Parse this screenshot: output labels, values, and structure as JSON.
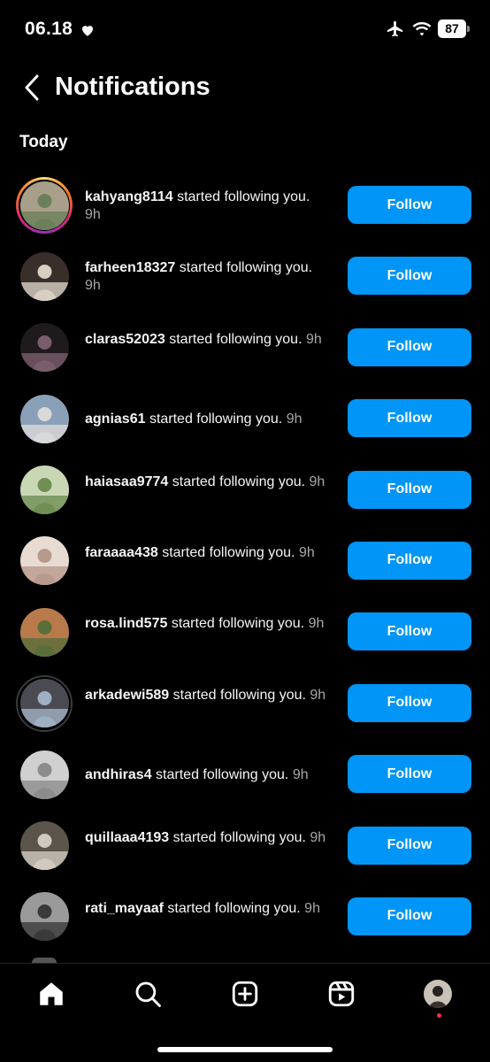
{
  "status_bar": {
    "time": "06.18",
    "battery": "87"
  },
  "header": {
    "title": "Notifications"
  },
  "section": {
    "title": "Today"
  },
  "notifications": [
    {
      "username": "kahyang8114",
      "action": "started following you.",
      "time": "9h",
      "avatar_colors": [
        "#6b7f5a",
        "#a89f8a"
      ]
    },
    {
      "username": "farheen18327",
      "action": "started following you.",
      "time": "9h",
      "avatar_colors": [
        "#d8cfc4",
        "#3a2e2a"
      ]
    },
    {
      "username": "claras52023",
      "action": "started following you.",
      "time": "9h",
      "avatar_colors": [
        "#7a5d6d",
        "#1f1a1c"
      ]
    },
    {
      "username": "agnias61",
      "action": "started following you.",
      "time": "9h",
      "avatar_colors": [
        "#d9d9d9",
        "#8aa0b8"
      ]
    },
    {
      "username": "haiasaa9774",
      "action": "started following you.",
      "time": "9h",
      "avatar_colors": [
        "#6f8f55",
        "#c9d7b5"
      ]
    },
    {
      "username": "faraaaa438",
      "action": "started following you.",
      "time": "9h",
      "avatar_colors": [
        "#b89a8c",
        "#e8dcd2"
      ]
    },
    {
      "username": "rosa.lind575",
      "action": "started following you.",
      "time": "9h",
      "avatar_colors": [
        "#5a6e3a",
        "#b87a4a"
      ]
    },
    {
      "username": "arkadewi589",
      "action": "started following you.",
      "time": "9h",
      "avatar_colors": [
        "#9fb0c2",
        "#4a4a52"
      ]
    },
    {
      "username": "andhiras4",
      "action": "started following you.",
      "time": "9h",
      "avatar_colors": [
        "#8c8c8c",
        "#d0d0d0"
      ]
    },
    {
      "username": "quillaaa4193",
      "action": "started following you.",
      "time": "9h",
      "avatar_colors": [
        "#cfc9c0",
        "#5a544a"
      ]
    },
    {
      "username": "rati_mayaaf",
      "action": "started following you.",
      "time": "9h",
      "avatar_colors": [
        "#3a3a3a",
        "#9a9a9a"
      ]
    }
  ],
  "follow_label": "Follow",
  "colors": {
    "accent": "#0095f6",
    "background": "#000000",
    "muted": "#a8a8a8"
  },
  "tab_bar": {
    "items": [
      {
        "icon": "home-icon"
      },
      {
        "icon": "search-icon"
      },
      {
        "icon": "create-icon"
      },
      {
        "icon": "reels-icon"
      },
      {
        "icon": "profile-avatar"
      }
    ]
  }
}
